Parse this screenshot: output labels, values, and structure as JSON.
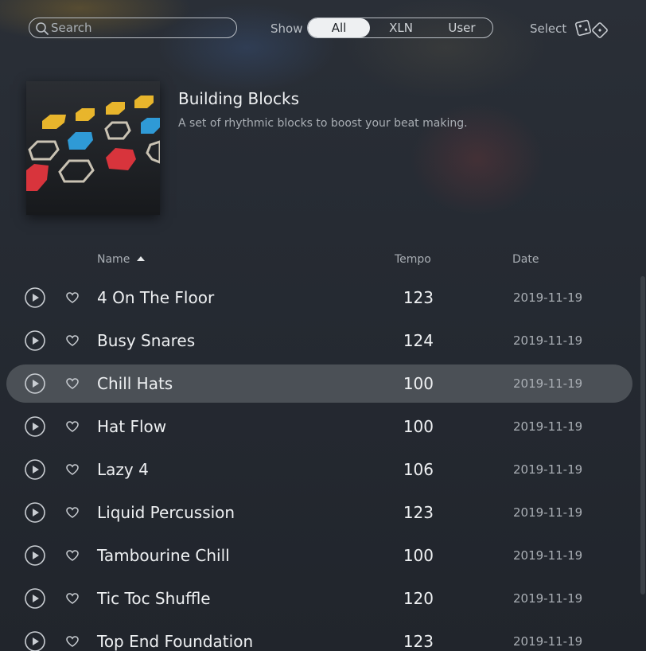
{
  "toolbar": {
    "search_placeholder": "Search",
    "show_label": "Show",
    "show_options": [
      "All",
      "XLN",
      "User"
    ],
    "show_selected": "All",
    "select_label": "Select",
    "dice_icon": "dice-icon"
  },
  "pack": {
    "title": "Building Blocks",
    "description": "A set of rhythmic blocks to boost your beat making."
  },
  "columns": {
    "name": "Name",
    "tempo": "Tempo",
    "date": "Date",
    "sort": "ascending"
  },
  "rows": [
    {
      "name": "4 On The Floor",
      "tempo": "123",
      "date": "2019-11-19"
    },
    {
      "name": "Busy Snares",
      "tempo": "124",
      "date": "2019-11-19"
    },
    {
      "name": "Chill Hats",
      "tempo": "100",
      "date": "2019-11-19"
    },
    {
      "name": "Hat Flow",
      "tempo": "100",
      "date": "2019-11-19"
    },
    {
      "name": "Lazy 4",
      "tempo": "106",
      "date": "2019-11-19"
    },
    {
      "name": "Liquid Percussion",
      "tempo": "123",
      "date": "2019-11-19"
    },
    {
      "name": "Tambourine Chill",
      "tempo": "100",
      "date": "2019-11-19"
    },
    {
      "name": "Tic Toc Shuffle",
      "tempo": "120",
      "date": "2019-11-19"
    },
    {
      "name": "Top End Foundation",
      "tempo": "123",
      "date": "2019-11-19"
    }
  ],
  "selected_row": "Chill Hats",
  "colors": {
    "background": "#232831",
    "selected_row": "#4b5056",
    "segment_active": "#eef0f2",
    "cover_yellow": "#e8b52c",
    "cover_blue": "#2f9ad6",
    "cover_red": "#d8343c"
  }
}
